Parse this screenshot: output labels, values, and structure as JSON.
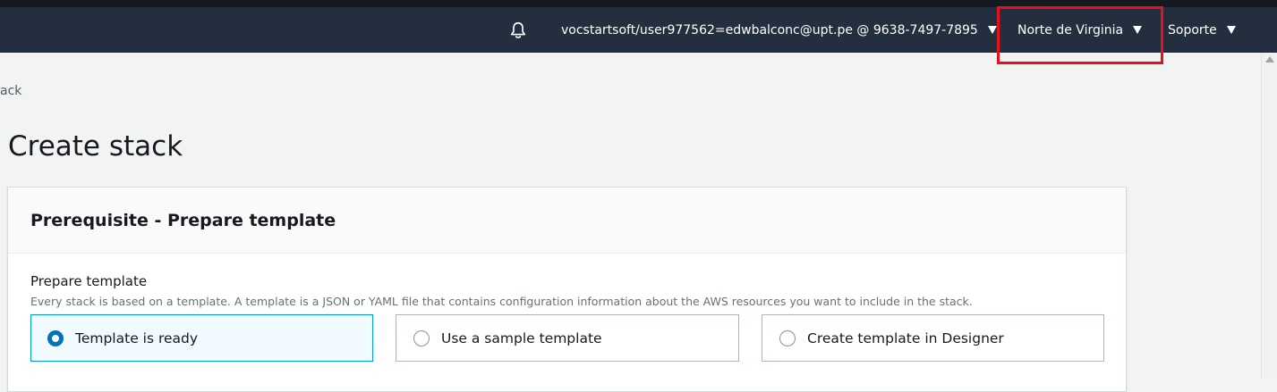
{
  "topnav": {
    "notifications_icon": "bell-icon",
    "account_label": "vocstartsoft/user977562=edwbalconc@upt.pe @ 9638-7497-7895",
    "region_label": "Norte de Virginia",
    "support_label": "Soporte"
  },
  "breadcrumb": {
    "current": "ack"
  },
  "page": {
    "title": "Create stack"
  },
  "panel": {
    "title": "Prerequisite - Prepare template",
    "field_label": "Prepare template",
    "field_description": "Every stack is based on a template. A template is a JSON or YAML file that contains configuration information about the AWS resources you want to include in the stack.",
    "options": [
      {
        "label": "Template is ready",
        "selected": true
      },
      {
        "label": "Use a sample template",
        "selected": false
      },
      {
        "label": "Create template in Designer",
        "selected": false
      }
    ]
  },
  "colors": {
    "navbar": "#232f3e",
    "highlight": "#e8101a",
    "selected_border": "#00a1c9",
    "radio_checked": "#0073bb"
  }
}
